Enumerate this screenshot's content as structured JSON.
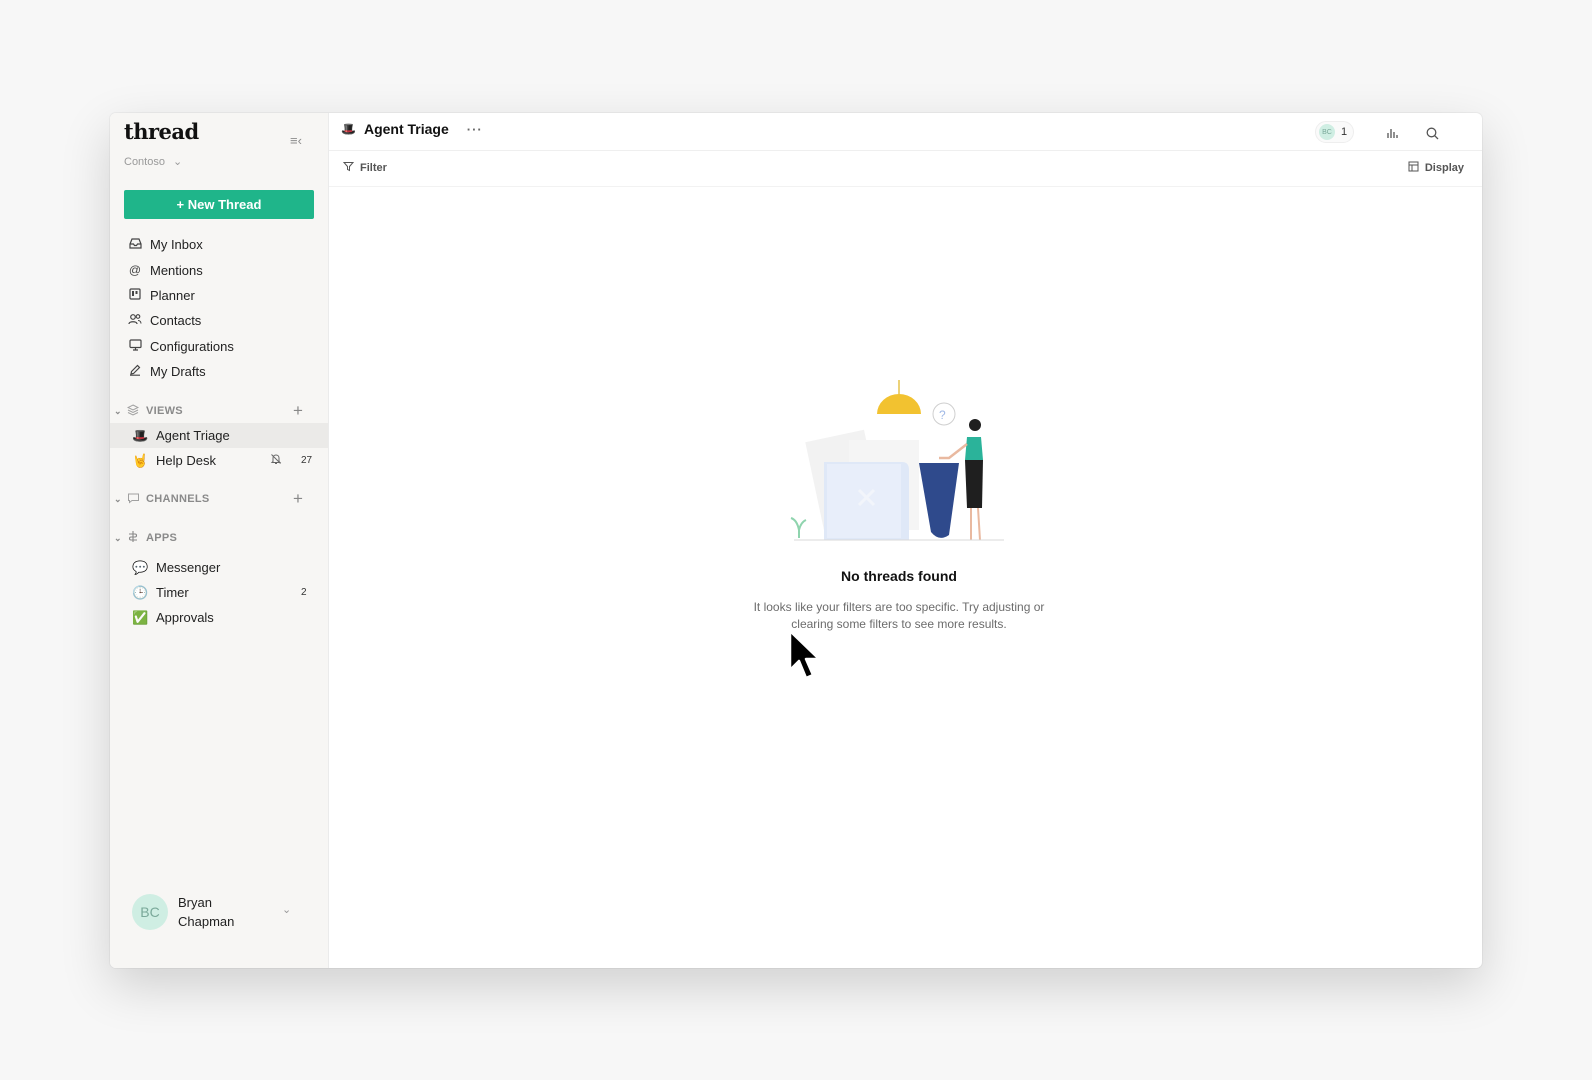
{
  "app": {
    "brand": "thread",
    "workspace": "Contoso"
  },
  "sidebar": {
    "new_thread_label": "+ New Thread",
    "nav": [
      {
        "label": "My Inbox",
        "icon": "inbox-icon"
      },
      {
        "label": "Mentions",
        "icon": "at-icon"
      },
      {
        "label": "Planner",
        "icon": "planner-icon"
      },
      {
        "label": "Contacts",
        "icon": "contacts-icon"
      },
      {
        "label": "Configurations",
        "icon": "monitor-icon"
      },
      {
        "label": "My Drafts",
        "icon": "pencil-icon"
      }
    ],
    "views": {
      "title": "VIEWS",
      "items": [
        {
          "label": "Agent Triage",
          "emoji": "🎩",
          "active": true
        },
        {
          "label": "Help Desk",
          "emoji": "🤘",
          "count": "27",
          "muted": true
        }
      ]
    },
    "channels": {
      "title": "CHANNELS"
    },
    "apps": {
      "title": "APPS",
      "items": [
        {
          "label": "Messenger",
          "emoji": "💬"
        },
        {
          "label": "Timer",
          "emoji": "🕒",
          "count": "2"
        },
        {
          "label": "Approvals",
          "emoji": "✅"
        }
      ]
    },
    "user": {
      "initials": "BC",
      "name": "Bryan Chapman"
    }
  },
  "header": {
    "view_title": "Agent Triage",
    "view_emoji": "🎩",
    "presence_initials": "BC",
    "presence_count": "1"
  },
  "toolbar": {
    "filter_label": "Filter",
    "display_label": "Display"
  },
  "empty_state": {
    "title": "No threads found",
    "description": "It looks like your filters are too specific. Try adjusting or clearing some filters to see more results."
  },
  "colors": {
    "accent": "#1fb58a",
    "sidebar_bg": "#f7f6f4",
    "illustration_yellow": "#f2c230",
    "illustration_blue": "#2f4a8c"
  }
}
